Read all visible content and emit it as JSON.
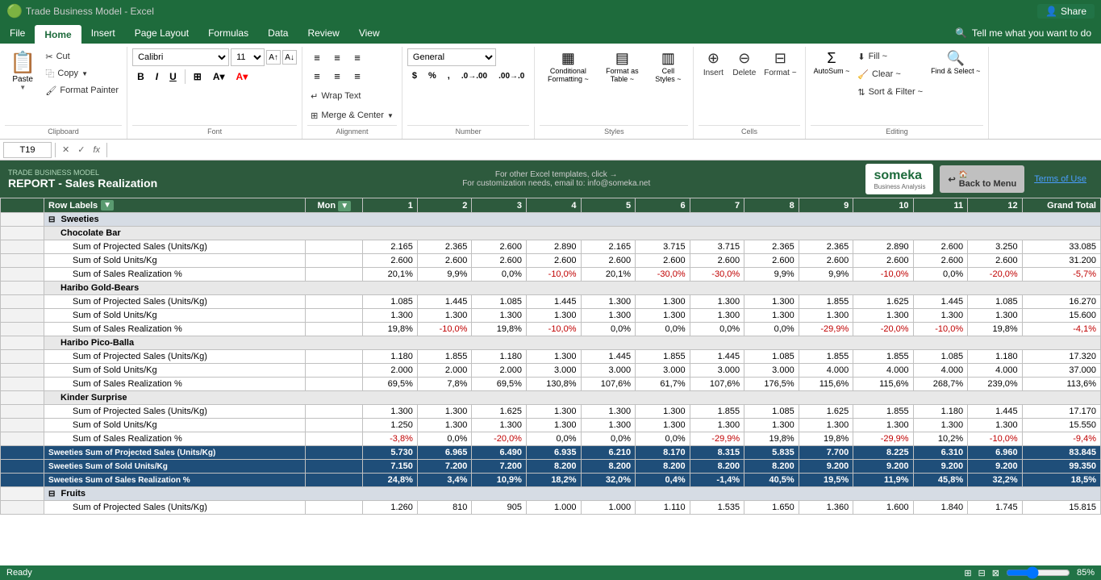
{
  "titlebar": {
    "appname": "Microsoft Excel",
    "filename": "Trade Business Model - Excel",
    "share_label": "Share"
  },
  "menubar": {
    "items": [
      "File",
      "Home",
      "Insert",
      "Page Layout",
      "Formulas",
      "Data",
      "Review",
      "View"
    ],
    "active": "Home",
    "search_placeholder": "Tell me what you want to do"
  },
  "ribbon": {
    "clipboard": {
      "label": "Clipboard",
      "paste_label": "Paste",
      "cut_label": "Cut",
      "copy_label": "Copy",
      "format_painter_label": "Format Painter"
    },
    "font": {
      "label": "Font",
      "font_name": "Calibri",
      "font_size": "11",
      "bold": "B",
      "italic": "I",
      "underline": "U"
    },
    "alignment": {
      "label": "Alignment",
      "wrap_text": "Wrap Text",
      "merge_center": "Merge & Center"
    },
    "number": {
      "label": "Number",
      "format": "General"
    },
    "styles": {
      "label": "Styles",
      "conditional_formatting": "Conditional Formatting ~",
      "format_as_table": "Format as Table ~",
      "cell_styles": "Cell Styles ~"
    },
    "cells": {
      "label": "Cells",
      "insert": "Insert",
      "delete": "Delete",
      "format": "Format ~"
    },
    "editing": {
      "label": "Editing",
      "autosum": "AutoSum ~",
      "fill": "Fill ~",
      "clear": "Clear ~",
      "sort_filter": "Sort & Filter ~",
      "find_select": "Find & Select ~"
    }
  },
  "formula_bar": {
    "cell_ref": "T19",
    "formula": ""
  },
  "header": {
    "subtitle": "TRADE BUSINESS MODEL",
    "title": "REPORT - Sales Realization",
    "promo_text": "For other Excel templates, click →",
    "promo_sub": "For customization needs, email to: info@someka.net",
    "logo_text": "someka",
    "logo_sub": "Business Analysis",
    "back_btn": "Back to Menu",
    "terms_label": "Terms of Use"
  },
  "table": {
    "pivot_header": "Row Labels",
    "month_header": "Mon",
    "col_headers": [
      "1",
      "2",
      "3",
      "4",
      "5",
      "6",
      "7",
      "8",
      "9",
      "10",
      "11",
      "12",
      "Grand Total"
    ],
    "sections": [
      {
        "name": "Sweeties",
        "type": "section",
        "products": [
          {
            "name": "Chocolate Bar",
            "rows": [
              {
                "label": "Sum of Projected Sales (Units/Kg)",
                "values": [
                  "2.165",
                  "2.365",
                  "2.600",
                  "2.890",
                  "2.165",
                  "3.715",
                  "3.715",
                  "2.365",
                  "2.365",
                  "2.890",
                  "2.600",
                  "3.250",
                  "33.085"
                ],
                "style": "normal"
              },
              {
                "label": "Sum of Sold Units/Kg",
                "values": [
                  "2.600",
                  "2.600",
                  "2.600",
                  "2.600",
                  "2.600",
                  "2.600",
                  "2.600",
                  "2.600",
                  "2.600",
                  "2.600",
                  "2.600",
                  "2.600",
                  "31.200"
                ],
                "style": "normal"
              },
              {
                "label": "Sum of Sales Realization %",
                "values": [
                  "20,1%",
                  "9,9%",
                  "0,0%",
                  "-10,0%",
                  "20,1%",
                  "-30,0%",
                  "-30,0%",
                  "9,9%",
                  "9,9%",
                  "-10,0%",
                  "0,0%",
                  "-20,0%",
                  "-5,7%"
                ],
                "style": "percent"
              }
            ]
          },
          {
            "name": "Haribo Gold-Bears",
            "rows": [
              {
                "label": "Sum of Projected Sales (Units/Kg)",
                "values": [
                  "1.085",
                  "1.445",
                  "1.085",
                  "1.445",
                  "1.300",
                  "1.300",
                  "1.300",
                  "1.300",
                  "1.855",
                  "1.625",
                  "1.445",
                  "1.085",
                  "16.270"
                ],
                "style": "normal"
              },
              {
                "label": "Sum of Sold Units/Kg",
                "values": [
                  "1.300",
                  "1.300",
                  "1.300",
                  "1.300",
                  "1.300",
                  "1.300",
                  "1.300",
                  "1.300",
                  "1.300",
                  "1.300",
                  "1.300",
                  "1.300",
                  "15.600"
                ],
                "style": "normal"
              },
              {
                "label": "Sum of Sales Realization %",
                "values": [
                  "19,8%",
                  "-10,0%",
                  "19,8%",
                  "-10,0%",
                  "0,0%",
                  "0,0%",
                  "0,0%",
                  "0,0%",
                  "-29,9%",
                  "-20,0%",
                  "-10,0%",
                  "19,8%",
                  "-4,1%"
                ],
                "style": "percent"
              }
            ]
          },
          {
            "name": "Haribo Pico-Balla",
            "rows": [
              {
                "label": "Sum of Projected Sales (Units/Kg)",
                "values": [
                  "1.180",
                  "1.855",
                  "1.180",
                  "1.300",
                  "1.445",
                  "1.855",
                  "1.445",
                  "1.085",
                  "1.855",
                  "1.855",
                  "1.085",
                  "1.180",
                  "17.320"
                ],
                "style": "normal"
              },
              {
                "label": "Sum of Sold Units/Kg",
                "values": [
                  "2.000",
                  "2.000",
                  "2.000",
                  "3.000",
                  "3.000",
                  "3.000",
                  "3.000",
                  "3.000",
                  "4.000",
                  "4.000",
                  "4.000",
                  "4.000",
                  "37.000"
                ],
                "style": "normal"
              },
              {
                "label": "Sum of Sales Realization %",
                "values": [
                  "69,5%",
                  "7,8%",
                  "69,5%",
                  "130,8%",
                  "107,6%",
                  "61,7%",
                  "107,6%",
                  "176,5%",
                  "115,6%",
                  "115,6%",
                  "268,7%",
                  "239,0%",
                  "113,6%"
                ],
                "style": "positive_percent"
              }
            ]
          },
          {
            "name": "Kinder Surprise",
            "rows": [
              {
                "label": "Sum of Projected Sales (Units/Kg)",
                "values": [
                  "1.300",
                  "1.300",
                  "1.625",
                  "1.300",
                  "1.300",
                  "1.300",
                  "1.855",
                  "1.085",
                  "1.625",
                  "1.855",
                  "1.180",
                  "1.445",
                  "17.170"
                ],
                "style": "normal"
              },
              {
                "label": "Sum of Sold Units/Kg",
                "values": [
                  "1.250",
                  "1.300",
                  "1.300",
                  "1.300",
                  "1.300",
                  "1.300",
                  "1.300",
                  "1.300",
                  "1.300",
                  "1.300",
                  "1.300",
                  "1.300",
                  "15.550"
                ],
                "style": "normal"
              },
              {
                "label": "Sum of Sales Realization %",
                "values": [
                  "-3,8%",
                  "0,0%",
                  "-20,0%",
                  "0,0%",
                  "0,0%",
                  "0,0%",
                  "-29,9%",
                  "19,8%",
                  "19,8%",
                  "-29,9%",
                  "10,2%",
                  "-10,0%",
                  "-9,4%"
                ],
                "style": "percent"
              }
            ]
          }
        ],
        "subtotals": [
          {
            "label": "Sweeties Sum of Projected Sales (Units/Kg)",
            "values": [
              "5.730",
              "6.965",
              "6.490",
              "6.935",
              "6.210",
              "8.170",
              "8.315",
              "5.835",
              "7.700",
              "8.225",
              "6.310",
              "6.960",
              "83.845"
            ],
            "style": "subtotal"
          },
          {
            "label": "Sweeties Sum of Sold Units/Kg",
            "values": [
              "7.150",
              "7.200",
              "7.200",
              "8.200",
              "8.200",
              "8.200",
              "8.200",
              "8.200",
              "9.200",
              "9.200",
              "9.200",
              "9.200",
              "99.350"
            ],
            "style": "subtotal"
          },
          {
            "label": "Sweeties Sum of Sales Realization %",
            "values": [
              "24,8%",
              "3,4%",
              "10,9%",
              "18,2%",
              "32,0%",
              "0,4%",
              "-1,4%",
              "40,5%",
              "19,5%",
              "11,9%",
              "45,8%",
              "32,2%",
              "18,5%"
            ],
            "style": "subtotal_percent"
          }
        ]
      },
      {
        "name": "Fruits",
        "type": "section",
        "products": [
          {
            "name": "",
            "rows": [
              {
                "label": "Sum of Projected Sales (Units/Kg)",
                "values": [
                  "1.260",
                  "810",
                  "905",
                  "1.000",
                  "1.000",
                  "1.110",
                  "1.535",
                  "1.650",
                  "1.360",
                  "1.600",
                  "1.840",
                  "1.745",
                  "15.815"
                ],
                "style": "normal"
              }
            ]
          }
        ],
        "subtotals": []
      }
    ]
  },
  "status_bar": {
    "ready": "Ready",
    "zoom": "85%"
  }
}
